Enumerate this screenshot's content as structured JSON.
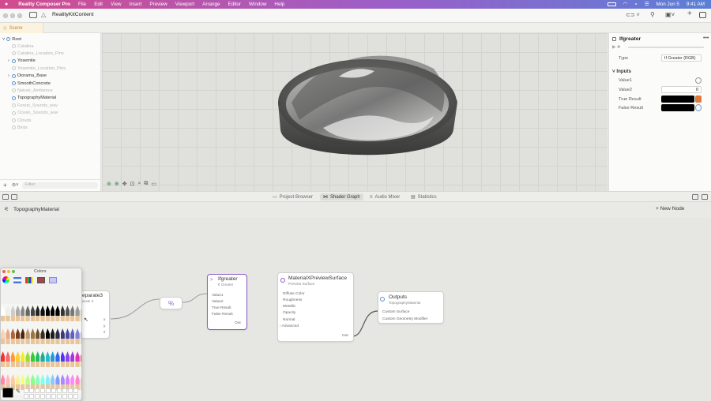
{
  "menubar": {
    "app": "Reality Composer Pro",
    "items": [
      "File",
      "Edit",
      "View",
      "Insert",
      "Preview",
      "Viewport",
      "Arrange",
      "Editor",
      "Window",
      "Help"
    ],
    "date": "Mon Jun 5",
    "time": "9:41 AM"
  },
  "toolbar": {
    "project": "RealityKitContent"
  },
  "scene_tab": {
    "label": "Scene"
  },
  "hierarchy": {
    "root": "Root",
    "items": [
      {
        "label": "Catalina",
        "dim": true,
        "expand": false
      },
      {
        "label": "Catalina_Location_Pins",
        "dim": true,
        "expand": false
      },
      {
        "label": "Yosemite",
        "dim": false,
        "expand": true
      },
      {
        "label": "Yosemite_Location_Pins",
        "dim": true,
        "expand": false
      },
      {
        "label": "Diorama_Base",
        "dim": false,
        "expand": true
      },
      {
        "label": "SmoothConcrete",
        "dim": false,
        "expand": false
      },
      {
        "label": "Nature_Ambience",
        "dim": true,
        "expand": false
      },
      {
        "label": "TopographyMaterial",
        "dim": false,
        "expand": false
      },
      {
        "label": "Forest_Sounds_wav",
        "dim": true,
        "expand": false
      },
      {
        "label": "Ocean_Sounds_wav",
        "dim": true,
        "expand": false
      },
      {
        "label": "Clouds",
        "dim": true,
        "expand": false
      },
      {
        "label": "Birds",
        "dim": true,
        "expand": false
      }
    ],
    "filter_placeholder": "Filter"
  },
  "inspector": {
    "title": "Ifgreater",
    "type_label": "Type",
    "type_value": "If Greater (RGB)",
    "inputs_header": "Inputs",
    "value1_label": "Value1",
    "value2_label": "Value2",
    "value2": "0",
    "true_label": "True Result",
    "false_label": "False Result",
    "true_color": "#000000",
    "false_color": "#000000"
  },
  "bottom_tabs": [
    "Project Browser",
    "Shader Graph",
    "Audio Mixer",
    "Statistics"
  ],
  "active_tab": "Shader Graph",
  "graph": {
    "material": "TopographyMaterial",
    "new_node": "New Node",
    "separate": {
      "title": "eparate3",
      "subtitle": "arate 3",
      "ports": [
        "x",
        "y",
        "z"
      ]
    },
    "modulo": {
      "symbol": "%"
    },
    "ifgreater": {
      "title": "Ifgreater",
      "subtitle": "If Greater",
      "inputs": [
        "Value1",
        "Value2",
        "True Result",
        "False Result"
      ],
      "output": "Out"
    },
    "surface": {
      "title": "MaterialXPreviewSurface",
      "subtitle": "Preview Surface",
      "inputs": [
        "Diffuse Color",
        "Roughness",
        "Metallic",
        "Opacity",
        "Normal",
        "Advanced"
      ],
      "output": "Out"
    },
    "outputs": {
      "title": "Outputs",
      "subtitle": "TopographyMaterial",
      "inputs": [
        "Custom Surface",
        "Custom Geometry Modifier"
      ]
    }
  },
  "colors_panel": {
    "title": "Colors",
    "current_color": "#000000"
  },
  "accent": "#8a5cc7"
}
